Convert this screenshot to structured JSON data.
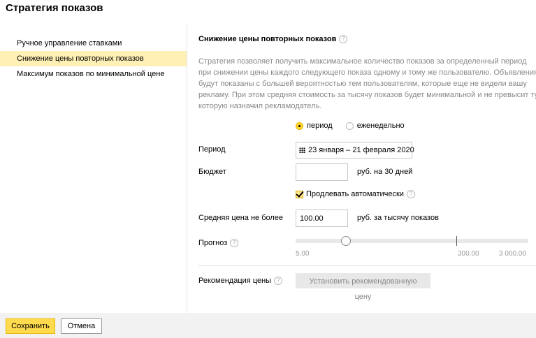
{
  "dialog": {
    "title": "Стратегия показов"
  },
  "sidebar": {
    "items": [
      {
        "label": "Ручное управление ставками"
      },
      {
        "label": "Снижение цены повторных показов"
      },
      {
        "label": "Максимум показов по минимальной цене"
      }
    ]
  },
  "main": {
    "title": "Снижение цены повторных показов",
    "description": "Стратегия позволяет получить максимальное количество показов за определенный период при снижении цены каждого следующего показа одному и тому же пользователю. Объявления будут показаны с большей вероятностью тем пользователям, которые еще не видели вашу рекламу. При этом средняя стоимость за тысячу показов будет минимальной и не превысит ту, которую назначил рекламодатель.",
    "radio_period": "период",
    "radio_weekly": "еженедельно",
    "period_label": "Период",
    "period_value": "23 января – 21 февраля 2020",
    "budget_label": "Бюджет",
    "budget_value": "",
    "budget_unit": "руб. на 30 дней",
    "auto_extend_label": "Продлевать автоматически",
    "auto_extend_checked": true,
    "avg_price_label": "Средняя цена не более",
    "avg_price_value": "100.00",
    "avg_price_unit": "руб. за тысячу показов",
    "forecast_label": "Прогноз",
    "forecast_ticks": [
      "5.00",
      "300.00",
      "3 000.00"
    ],
    "recommendation_label": "Рекомендация цены",
    "recommendation_button": "Установить рекомендованную цену"
  },
  "footer": {
    "save": "Сохранить",
    "cancel": "Отмена"
  },
  "colors": {
    "accent": "#ffdb4d",
    "selected_bg": "#fff0b5"
  },
  "icons": {
    "help": "question-circle-icon",
    "calendar": "calendar-icon"
  }
}
